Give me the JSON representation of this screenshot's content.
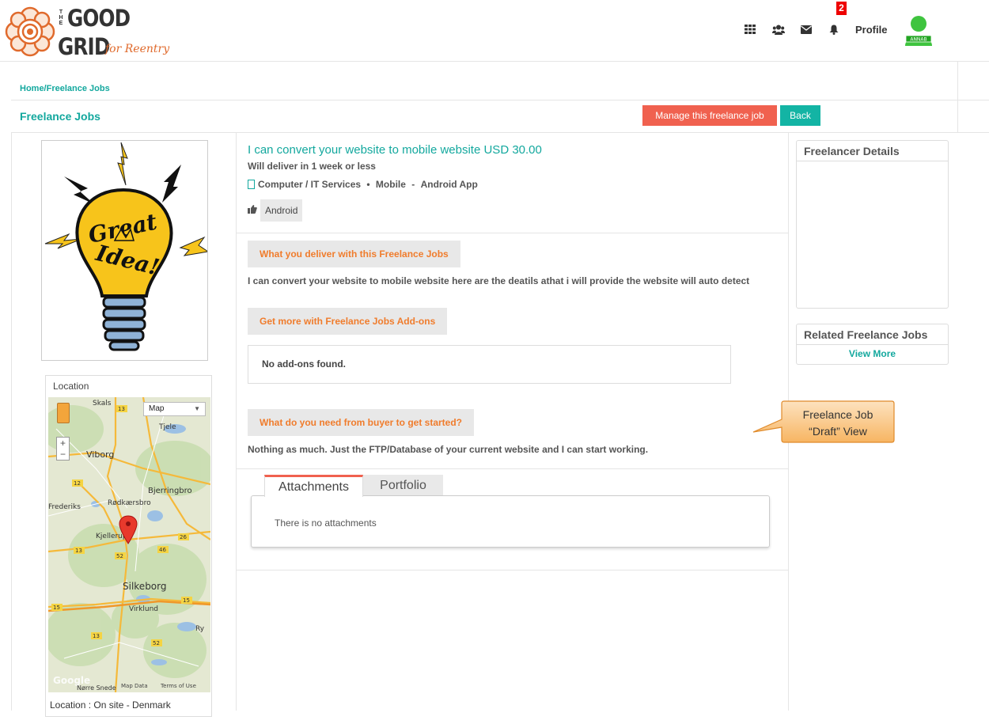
{
  "header": {
    "logo": {
      "top": "THE",
      "line1": "GOOD",
      "line2": "GRID",
      "tagline": "for Reentry"
    },
    "icons": [
      "grid-apps-icon",
      "users-icon",
      "envelope-icon",
      "bell-icon"
    ],
    "notification_count": "2",
    "profile_label": "Profile",
    "avatar_label": "ANNAB"
  },
  "breadcrumb": "Home/Freelance Jobs",
  "page_title": "Freelance Jobs",
  "buttons": {
    "manage": "Manage this freelance job",
    "back": "Back"
  },
  "job": {
    "title": "I can convert your website to mobile website USD 30.00",
    "deliver": "Will deliver in 1 week or less",
    "category": "Computer / IT Services",
    "subcategory": "Mobile",
    "type": "Android App",
    "tag": "Android",
    "image_text": [
      "Great",
      "Idea!"
    ]
  },
  "sections": {
    "deliver_heading": "What you deliver with this Freelance Jobs",
    "deliver_text": "I can convert your website to mobile website here are the deatils athat i will provide the website will auto detect",
    "addons_heading": "Get more with Freelance Jobs Add-ons",
    "addons_text": "No add-ons found.",
    "need_heading": "What do you need from buyer to get started?",
    "need_text": "Nothing as much. Just the FTP/Database of your current website and I can start working."
  },
  "tabs": {
    "attachments": "Attachments",
    "portfolio": "Portfolio",
    "attachments_text": "There is no attachments"
  },
  "location": {
    "title": "Location",
    "footer": "Location : On site - Denmark",
    "map_type": "Map",
    "map_labels": [
      "Skals",
      "Tjele",
      "Viborg",
      "Bjerringbro",
      "Frederiks",
      "Rødkærsbro",
      "Kjellerup",
      "Silkeborg",
      "Virklund",
      "Ry",
      "Nørre Snede"
    ],
    "road_numbers": [
      "13",
      "12",
      "26",
      "46",
      "52",
      "15",
      "15",
      "13",
      "52",
      "13"
    ],
    "map_footer": {
      "brand": "Google",
      "data": "Map Data",
      "terms": "Terms of Use"
    }
  },
  "sidebar": {
    "freelancer_details": "Freelancer Details",
    "related_jobs": "Related Freelance Jobs",
    "view_more": "View More"
  },
  "callout": {
    "line1": "Freelance Job",
    "line2": "“Draft” View"
  },
  "colors": {
    "accent": "#13a89e",
    "manage": "#f0614f",
    "back": "#13b4a4",
    "section_text": "#f07c2c",
    "callout_fill": "#f9c98f"
  }
}
